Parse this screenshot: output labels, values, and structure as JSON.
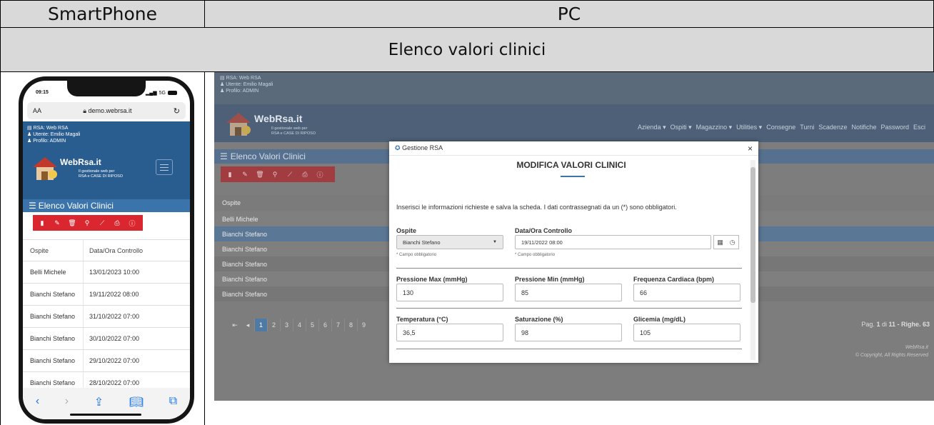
{
  "header": {
    "col_smartphone": "SmartPhone",
    "col_pc": "PC",
    "section_title": "Elenco valori clinici"
  },
  "app": {
    "rsa_line": "RSA: Web RSA",
    "user_line": "Utente: Emilio Magali",
    "profile_line": "Profilo: ADMIN",
    "logo_title": "WebRsa.it",
    "logo_sub1": "Il gestionale web per",
    "logo_sub2": "RSA e CASE DI RIPOSO",
    "page_title": "Elenco Valori Clinici"
  },
  "phone": {
    "time": "09:15",
    "signal": "5G",
    "aa": "AA",
    "url": "demo.webrsa.it",
    "col_ospite": "Ospite",
    "col_data": "Data/Ora Controllo",
    "rows": [
      {
        "ospite": "Belli Michele",
        "data": "13/01/2023 10:00"
      },
      {
        "ospite": "Bianchi Stefano",
        "data": "19/11/2022 08:00"
      },
      {
        "ospite": "Bianchi Stefano",
        "data": "31/10/2022 07:00"
      },
      {
        "ospite": "Bianchi Stefano",
        "data": "30/10/2022 07:00"
      },
      {
        "ospite": "Bianchi Stefano",
        "data": "29/10/2022 07:00"
      },
      {
        "ospite": "Bianchi Stefano",
        "data": "28/10/2022 07:00"
      }
    ]
  },
  "pc": {
    "menu": [
      "Azienda ▾",
      "Ospiti ▾",
      "Magazzino ▾",
      "Utilities ▾",
      "Consegne",
      "Turni",
      "Scadenze",
      "Notifiche",
      "Password",
      "Esci"
    ],
    "col_ospite": "Ospite",
    "rows": [
      "Belli Michele",
      "Bianchi Stefano",
      "Bianchi Stefano",
      "Bianchi Stefano",
      "Bianchi Stefano",
      "Bianchi Stefano"
    ],
    "pages": [
      "1",
      "2",
      "3",
      "4",
      "5",
      "6",
      "7",
      "8",
      "9"
    ],
    "pag_prefix": "Pag. ",
    "pag_current": "1",
    "pag_of": " di ",
    "pag_total": "11",
    "pag_rows": " - Righe. 63",
    "footer1": "WebRsa.it",
    "footer2": "© Copyright, All Rights Reserved"
  },
  "modal": {
    "window_title": "Gestione RSA",
    "title": "MODIFICA VALORI CLINICI",
    "intro": "Inserisci le informazioni richieste e salva la scheda. I dati contrassegnati da un (*) sono obbligatori.",
    "ospite_label": "Ospite",
    "ospite_value": "Bianchi Stefano",
    "data_label": "Data/Ora Controllo",
    "data_value": "19/11/2022 08:00",
    "required_hint": "* Campo obbligatorio",
    "pmax_label": "Pressione Max (mmHg)",
    "pmax_value": "130",
    "pmin_label": "Pressione Min (mmHg)",
    "pmin_value": "85",
    "fc_label": "Frequenza Cardiaca (bpm)",
    "fc_value": "66",
    "temp_label": "Temperatura (°C)",
    "temp_value": "36,5",
    "sat_label": "Saturazione (%)",
    "sat_value": "98",
    "gli_label": "Glicemia (mg/dL)",
    "gli_value": "105"
  }
}
